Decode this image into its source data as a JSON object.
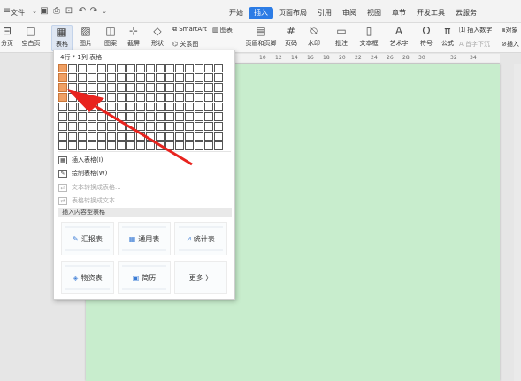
{
  "titlebar": {
    "file_menu": "文件",
    "tabs": [
      "开始",
      "插入",
      "页面布局",
      "引用",
      "审阅",
      "视图",
      "章节",
      "开发工具",
      "云服务"
    ],
    "active_tab": "插入"
  },
  "ribbon": {
    "fenye": "分页",
    "blank_page": "空白页",
    "table": "表格",
    "picture": "图片",
    "icons": "图案",
    "screenshot": "截屏",
    "shapes": "形状",
    "smartart": "SmartArt",
    "chart": "图表",
    "relation": "关系图",
    "header_footer": "页眉和页脚",
    "page_num": "页码",
    "watermark": "水印",
    "comment": "批注",
    "textbox": "文本框",
    "wordart": "艺术字",
    "symbol": "符号",
    "formula": "公式",
    "insert_number": "插入数字",
    "first_drop": "首字下沉",
    "object": "对象",
    "insert_more": "插入"
  },
  "ruler": [
    "10",
    "12",
    "14",
    "16",
    "18",
    "20",
    "22",
    "24",
    "26",
    "28",
    "30",
    "32",
    "34"
  ],
  "panel": {
    "grid_label": "4行 * 1列 表格",
    "grid_rows": 9,
    "grid_cols": 17,
    "selected_rows": 4,
    "selected_cols": 1,
    "menu": {
      "insert_table": "插入表格(I)",
      "draw_table": "绘制表格(W)",
      "text_to_table": "文本转换成表格...",
      "table_to_text": "表格转换成文本..."
    },
    "section_title": "插入内容型表格",
    "templates": [
      {
        "name": "汇报表",
        "icon": "✎"
      },
      {
        "name": "通用表",
        "icon": "▦"
      },
      {
        "name": "统计表",
        "icon": "⩘"
      },
      {
        "name": "物资表",
        "icon": "◈"
      },
      {
        "name": "简历",
        "icon": "▣"
      },
      {
        "name": "更多 〉",
        "icon": ""
      }
    ]
  },
  "colors": {
    "accent": "#2c7ce5",
    "page_bg": "#c8edcd",
    "selected_cell": "#f0a064",
    "arrow": "#e8231e"
  }
}
